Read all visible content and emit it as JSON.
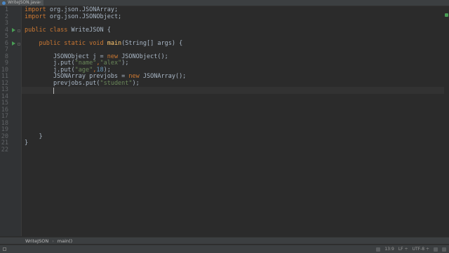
{
  "tab": {
    "filename": "WriteJSON.java",
    "close_glyph": "×"
  },
  "code": {
    "lines": [
      [
        {
          "t": "import ",
          "c": "kw"
        },
        {
          "t": "org.json.JSONArray;",
          "c": ""
        }
      ],
      [
        {
          "t": "import ",
          "c": "kw"
        },
        {
          "t": "org.json.JSONObject;",
          "c": ""
        }
      ],
      [],
      [
        {
          "t": "public class ",
          "c": "kw"
        },
        {
          "t": "WriteJSON {",
          "c": ""
        }
      ],
      [],
      [
        {
          "t": "    public static void ",
          "c": "kw"
        },
        {
          "t": "main",
          "c": "fn"
        },
        {
          "t": "(String[] args) {",
          "c": ""
        }
      ],
      [],
      [
        {
          "t": "        JSONObject j = ",
          "c": ""
        },
        {
          "t": "new ",
          "c": "kw"
        },
        {
          "t": "JSONObject();",
          "c": ""
        }
      ],
      [
        {
          "t": "        j.put(",
          "c": ""
        },
        {
          "t": "\"name\"",
          "c": "str"
        },
        {
          "t": ",",
          "c": "kw"
        },
        {
          "t": "\"alex\"",
          "c": "str"
        },
        {
          "t": ");",
          "c": ""
        }
      ],
      [
        {
          "t": "        j.put(",
          "c": ""
        },
        {
          "t": "\"age\"",
          "c": "str"
        },
        {
          "t": ",",
          "c": "kw"
        },
        {
          "t": "18",
          "c": "num"
        },
        {
          "t": ");",
          "c": ""
        }
      ],
      [
        {
          "t": "        JSONArray prevjobs = ",
          "c": ""
        },
        {
          "t": "new ",
          "c": "kw"
        },
        {
          "t": "JSONArray();",
          "c": ""
        }
      ],
      [
        {
          "t": "        prevjobs.put(",
          "c": ""
        },
        {
          "t": "\"student\"",
          "c": "str"
        },
        {
          "t": ");",
          "c": ""
        }
      ],
      [
        {
          "t": "        ",
          "c": ""
        }
      ],
      [],
      [],
      [],
      [],
      [],
      [],
      [
        {
          "t": "    }",
          "c": ""
        }
      ],
      [
        {
          "t": "}",
          "c": ""
        }
      ],
      []
    ],
    "line_numbers": [
      "1",
      "2",
      "3",
      "4",
      "5",
      "6",
      "7",
      "8",
      "9",
      "10",
      "11",
      "12",
      "13",
      "14",
      "15",
      "16",
      "17",
      "18",
      "19",
      "20",
      "21",
      "22"
    ],
    "current_line": 13,
    "run_markers": [
      4,
      6
    ]
  },
  "breadcrumb": {
    "class_name": "WriteJSON",
    "method_name": "main()"
  },
  "status": {
    "position": "13:9",
    "line_sep": "LF ÷",
    "encoding": "UTF-8 ÷"
  },
  "colors": {
    "keyword": "#cc7832",
    "string": "#6a8759",
    "number": "#6897bb",
    "method": "#ffc66d",
    "text": "#a9b7c6"
  }
}
